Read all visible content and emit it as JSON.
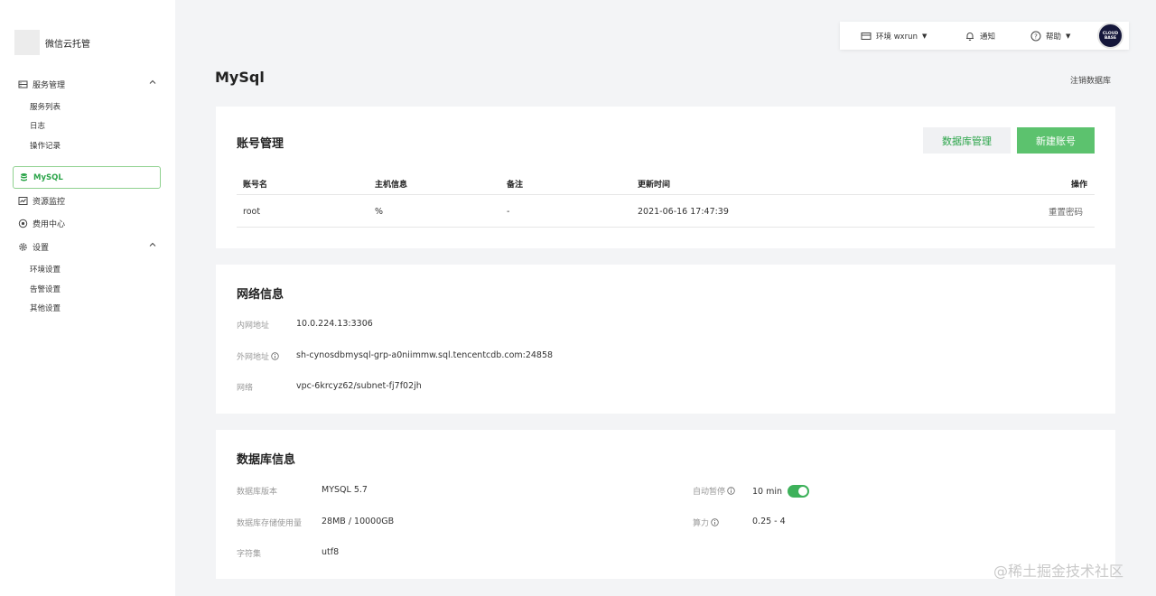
{
  "sidebar": {
    "brand": "微信云托管",
    "groups": [
      {
        "label": "服务管理",
        "icon": "server-icon",
        "subitems": [
          "服务列表",
          "日志",
          "操作记录"
        ]
      },
      {
        "label": "MySQL",
        "icon": "database-icon",
        "active": true
      },
      {
        "label": "资源监控",
        "icon": "monitor-icon"
      },
      {
        "label": "费用中心",
        "icon": "billing-icon"
      },
      {
        "label": "设置",
        "icon": "gear-icon",
        "subitems": [
          "环境设置",
          "告警设置",
          "其他设置"
        ]
      }
    ]
  },
  "topbar": {
    "env": "环境 wxrun",
    "notify": "通知",
    "help": "帮助",
    "avatar_text": [
      "CLOUD",
      "BASE"
    ]
  },
  "page": {
    "title": "MySql",
    "deregister": "注销数据库"
  },
  "accounts": {
    "title": "账号管理",
    "btn_manage": "数据库管理",
    "btn_new": "新建账号",
    "columns": [
      "账号名",
      "主机信息",
      "备注",
      "更新时间",
      "操作"
    ],
    "rows": [
      {
        "name": "root",
        "host": "%",
        "remark": "-",
        "updated": "2021-06-16 17:47:39",
        "action": "重置密码"
      }
    ]
  },
  "network": {
    "title": "网络信息",
    "items": [
      {
        "label": "内网地址",
        "value": "10.0.224.13:3306",
        "info": false
      },
      {
        "label": "外网地址",
        "value": "sh-cynosdbmysql-grp-a0niimmw.sql.tencentcdb.com:24858",
        "info": true
      },
      {
        "label": "网络",
        "value": "vpc-6krcyz62/subnet-fj7f02jh",
        "info": false
      }
    ]
  },
  "database": {
    "title": "数据库信息",
    "left": [
      {
        "label": "数据库版本",
        "value": "MYSQL 5.7"
      },
      {
        "label": "数据库存储使用量",
        "value": "28MB / 10000GB"
      },
      {
        "label": "字符集",
        "value": "utf8"
      }
    ],
    "right": [
      {
        "label": "自动暂停",
        "value": "10 min",
        "toggle_on": true
      },
      {
        "label": "算力",
        "value": "0.25 - 4"
      }
    ]
  },
  "watermark": "@稀土掘金技术社区",
  "colors": {
    "accent": "#2ca54a",
    "button": "#5cc26e"
  }
}
